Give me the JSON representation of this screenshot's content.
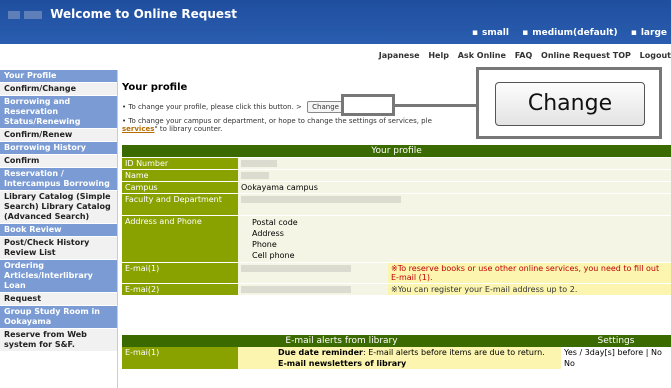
{
  "header": {
    "title": "Welcome to Online Request",
    "sizes": [
      "small",
      "medium(default)",
      "large"
    ]
  },
  "toplinks": [
    "Japanese",
    "Help",
    "Ask Online",
    "FAQ",
    "Online Request TOP",
    "Logout"
  ],
  "sidebar": [
    {
      "label": "Your Profile",
      "type": "head"
    },
    {
      "label": "Confirm/Change",
      "type": "link"
    },
    {
      "label": "Borrowing and Reservation Status/Renewing",
      "type": "head"
    },
    {
      "label": "Confirm/Renew",
      "type": "link"
    },
    {
      "label": "Borrowing History",
      "type": "head"
    },
    {
      "label": "Confirm",
      "type": "link"
    },
    {
      "label": "Reservation / Intercampus Borrowing",
      "type": "head"
    },
    {
      "label": "Library Catalog (Simple Search) Library Catalog (Advanced Search)",
      "type": "link"
    },
    {
      "label": "Book Review",
      "type": "head"
    },
    {
      "label": "Post/Check History Review List",
      "type": "link"
    },
    {
      "label": "Ordering Articles/Interlibrary Loan",
      "type": "head"
    },
    {
      "label": "Request",
      "type": "link"
    },
    {
      "label": "Group Study Room in Ookayama",
      "type": "head"
    },
    {
      "label": "Reserve from Web system for S&F.",
      "type": "link"
    }
  ],
  "main": {
    "heading": "Your profile",
    "bullet1": "To change your profile, please click this button. >",
    "change_label": "Change",
    "bullet2": "To change your campus or department, or hope to change the settings of services, ple",
    "bullet2_link": "services",
    "bullet2_tail": "\" to library counter.",
    "zoom_label": "Change"
  },
  "profile": {
    "header": "Your profile",
    "rows": {
      "id": "ID Number",
      "name": "Name",
      "campus": "Campus",
      "campus_value": "Ookayama campus",
      "faculty": "Faculty and Department",
      "address": "Address and Phone",
      "address_fields": [
        "Postal code",
        "Address",
        "Phone",
        "Cell phone"
      ],
      "email1": "E-mai(1)",
      "email1_note": "※To reserve books or use other online services, you need to fill out E-mail (1).",
      "email2": "E-mai(2)",
      "email2_note": "※You can register your E-mail address up to 2."
    }
  },
  "alerts": {
    "header": "E-mail alerts from library",
    "settings_header": "Settings",
    "email_label": "E-mai(1)",
    "due_title": "Due date reminder",
    "due_text": ": E-mail alerts before items are due to return.",
    "due_setting": "Yes / 3day[s] before",
    "due_setting_extra": "No",
    "news_title": "E-mail newsletters of library",
    "news_setting": "No"
  }
}
